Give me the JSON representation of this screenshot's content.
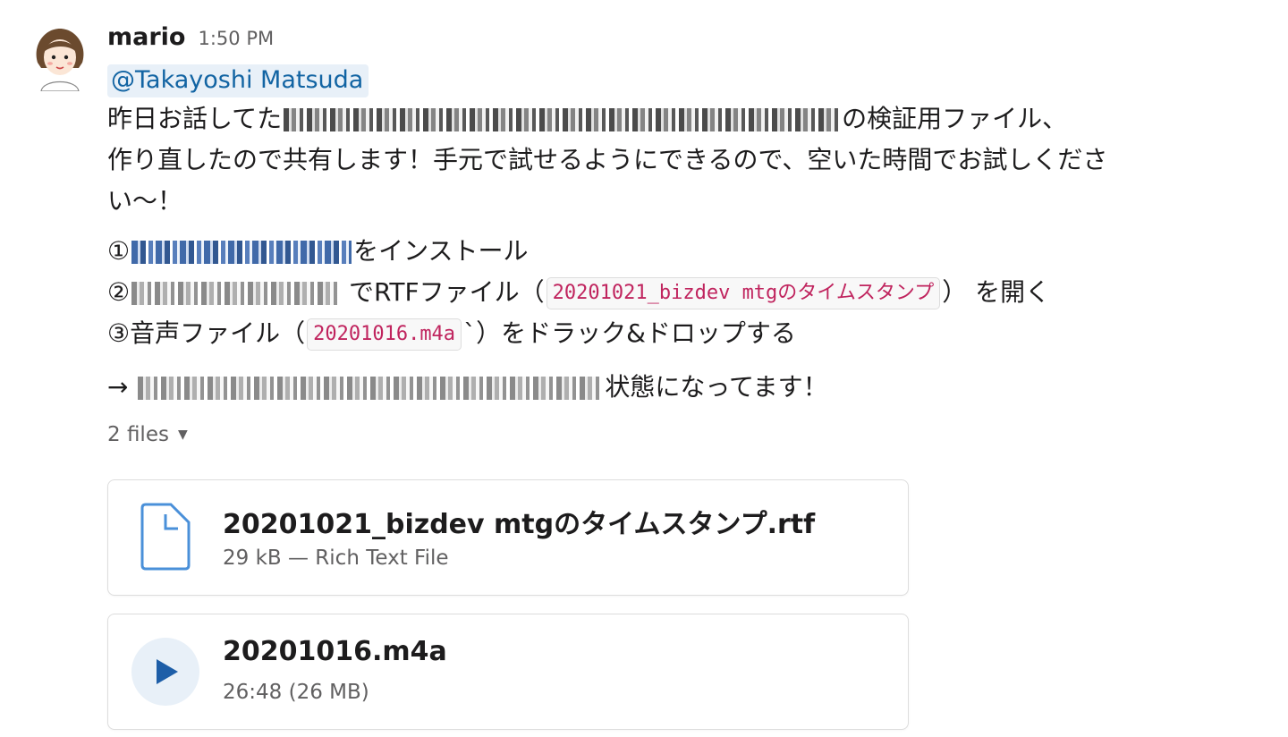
{
  "message": {
    "author": "mario",
    "time": "1:50 PM",
    "mention": "@Takayoshi Matsuda",
    "line1_before": "昨日お話してた",
    "line1_after": "の検証用ファイル、",
    "line2": "作り直したので共有します！手元で試せるようにできるので、空いた時間でお試しくださ",
    "line3": "い〜！",
    "step1_num": "①",
    "step1_after": "をインストール",
    "step2_num": "②",
    "step2_mid": " でRTFファイル（",
    "step2_code": "20201021_bizdev mtgのタイムスタンプ",
    "step2_after": "） を開く",
    "step3_before": "③音声ファイル（",
    "step3_code": "20201016.m4a",
    "step3_after": "`）をドラック&ドロップする",
    "arrow_before": "→",
    "arrow_after": "状態になってます！"
  },
  "files": {
    "toggle_label": "2 files",
    "items": [
      {
        "name": "20201021_bizdev mtgのタイムスタンプ.rtf",
        "meta": "29 kB — Rich Text File",
        "icon": "document-icon"
      },
      {
        "name": "20201016.m4a",
        "meta": "26:48 (26 MB)",
        "icon": "play-icon"
      }
    ]
  },
  "colors": {
    "mention_bg": "#e8f0f8",
    "mention_text": "#1264a3",
    "code_text": "#c0245e",
    "icon_blue": "#4a90d9"
  }
}
